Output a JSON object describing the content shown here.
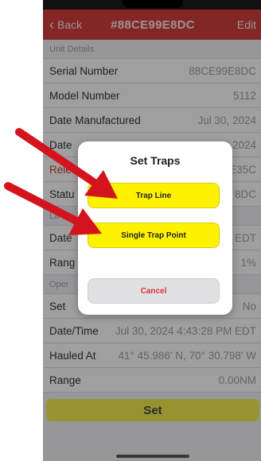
{
  "nav": {
    "back_label": "Back",
    "title": "#88CE99E8DC",
    "edit_label": "Edit"
  },
  "sections": {
    "unit_details": "Unit Details",
    "last": "La",
    "oper": "Oper"
  },
  "rows": {
    "serial": {
      "label": "Serial Number",
      "value": "88CE99E8DC"
    },
    "model": {
      "label": "Model Number",
      "value": "5112"
    },
    "manufactured": {
      "label": "Date Manufactured",
      "value": "Jul 30, 2024"
    },
    "date2": {
      "label": "Date",
      "value": "2024"
    },
    "release": {
      "label": "Relea",
      "value": "E35C"
    },
    "status": {
      "label": "Statu",
      "value": "8DC"
    },
    "date3": {
      "label": "Date",
      "value": "EDT"
    },
    "range1": {
      "label": "Rang",
      "value": "1%"
    },
    "set": {
      "label": "Set",
      "value": "No"
    },
    "datetime": {
      "label": "Date/Time",
      "value": "Jul 30, 2024 4:43:28 PM EDT"
    },
    "hauled": {
      "label": "Hauled At",
      "value": "41° 45.986' N, 70° 30.798' W"
    },
    "range2": {
      "label": "Range",
      "value": "0.00NM"
    }
  },
  "set_button_label": "Set",
  "dialog": {
    "title": "Set Traps",
    "trap_line": "Trap Line",
    "single_trap": "Single Trap Point",
    "cancel": "Cancel"
  },
  "colors": {
    "nav_red": "#c93b3b",
    "yellow": "#fff200",
    "arrow_red": "#d4141c"
  }
}
